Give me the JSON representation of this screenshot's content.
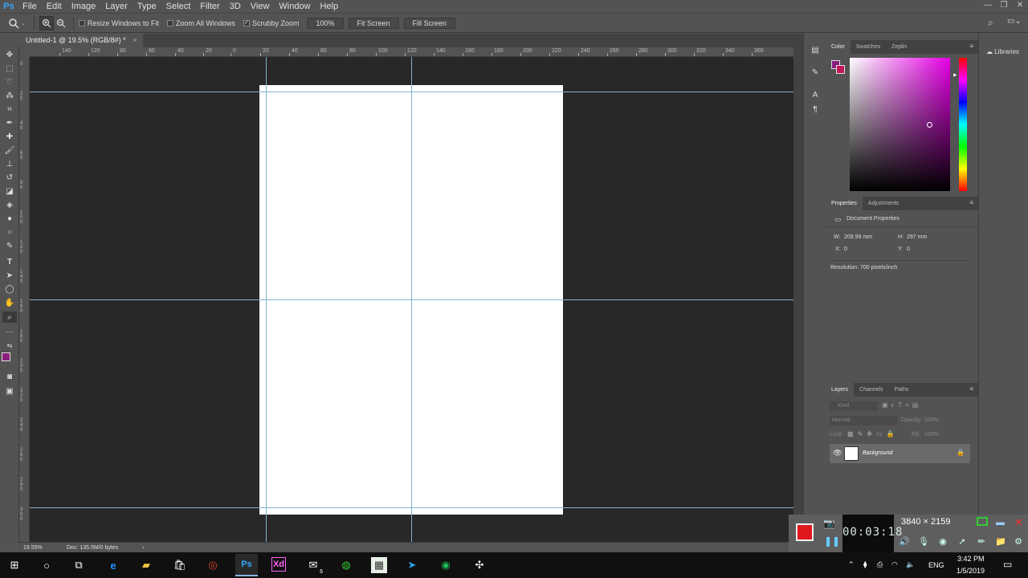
{
  "app": {
    "logo": "Ps",
    "menu": [
      "File",
      "Edit",
      "Image",
      "Layer",
      "Type",
      "Select",
      "Filter",
      "3D",
      "View",
      "Window",
      "Help"
    ]
  },
  "window_controls": {
    "minimize": "—",
    "restore": "❐",
    "close": "✕"
  },
  "options_bar": {
    "resize_windows": {
      "label": "Resize Windows to Fit",
      "checked": false
    },
    "zoom_all": {
      "label": "Zoom All Windows",
      "checked": false
    },
    "scrubby_zoom": {
      "label": "Scrubby Zoom",
      "checked": true
    },
    "zoom_value": "100%",
    "fit_screen": "Fit Screen",
    "fill_screen": "Fill Screen"
  },
  "document_tab": {
    "title": "Untitled-1 @ 19.5% (RGB/8#) *",
    "close": "×"
  },
  "ruler_top": [
    "140",
    "120",
    "80",
    "60",
    "40",
    "20",
    "0",
    "20",
    "40",
    "60",
    "80",
    "100",
    "120",
    "140",
    "160",
    "180",
    "200",
    "220",
    "240",
    "260",
    "280",
    "300",
    "320",
    "340",
    "360"
  ],
  "ruler_left": [
    "0",
    "2 0",
    "4 0",
    "6 0",
    "8 0",
    "1 0 0",
    "1 2 0",
    "1 4 0",
    "1 6 0",
    "1 8 0",
    "2 0 0",
    "2 2 0",
    "2 4 0",
    "2 6 0",
    "2 8 0",
    "3 0 0"
  ],
  "status_bar": {
    "zoom": "19.55%",
    "doc": "Doc: 135.5M/0 bytes",
    "arrow": "›"
  },
  "color_panel": {
    "tabs": [
      "Color",
      "Swatches",
      "Zeplin"
    ],
    "foreground": "#8a1f7e",
    "background": "#c2185b"
  },
  "properties_panel": {
    "tabs": [
      "Properties",
      "Adjustments"
    ],
    "title": "Document Properties",
    "w_label": "W:",
    "w_value": "209.99 mm",
    "h_label": "H:",
    "h_value": "297 mm",
    "x_label": "X:",
    "x_value": "0",
    "y_label": "Y:",
    "y_value": "0",
    "resolution": "Resolution: 700 pixels/inch"
  },
  "layers_panel": {
    "tabs": [
      "Layers",
      "Channels",
      "Paths"
    ],
    "kind": "Kind",
    "blend": "Normal",
    "opacity_label": "Opacity:",
    "opacity_value": "100%",
    "lock_label": "Lock:",
    "fill_label": "Fill:",
    "fill_value": "100%",
    "layer_name": "Background"
  },
  "libraries": {
    "label": "Libraries"
  },
  "recorder": {
    "timer": "00:03:18",
    "resolution": "3840 × 2159"
  },
  "taskbar": {
    "language": "ENG",
    "time": "3:42 PM",
    "date": "1/5/2019",
    "mail_badge": "6"
  }
}
